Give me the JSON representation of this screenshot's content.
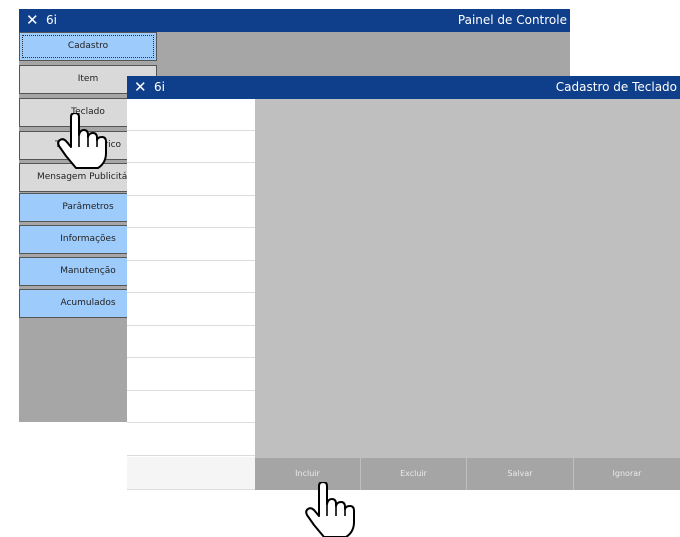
{
  "back_window": {
    "close_glyph": "✕",
    "app_label": "6i",
    "title": "Painel de Controle",
    "menu": [
      {
        "label": "Cadastro",
        "style": "blue",
        "selected": true
      },
      {
        "label": "Item",
        "style": "gray"
      },
      {
        "label": "Teclado",
        "style": "gray"
      },
      {
        "label": "Tecl. Numérico",
        "style": "gray"
      },
      {
        "label": "Mensagem Publicitária",
        "style": "gray"
      },
      {
        "label": "Parâmetros",
        "style": "blue"
      },
      {
        "label": "Informações",
        "style": "blue"
      },
      {
        "label": "Manutenção",
        "style": "blue"
      },
      {
        "label": "Acumulados",
        "style": "blue"
      }
    ]
  },
  "front_window": {
    "close_glyph": "✕",
    "app_label": "6i",
    "title": "Cadastro de Teclado",
    "footer_buttons": [
      {
        "label": "Incluir"
      },
      {
        "label": "Excluir"
      },
      {
        "label": "Salvar"
      },
      {
        "label": "Ignorar"
      }
    ]
  },
  "colors": {
    "titlebar": "#0f3f8b",
    "menu_blue": "#9dcbfb",
    "menu_gray": "#d9d9d9",
    "content_gray": "#c0bfc0",
    "button_gray": "#a5a5a5"
  },
  "icons": {
    "close": "close-icon",
    "pointer": "hand-pointer-icon"
  }
}
